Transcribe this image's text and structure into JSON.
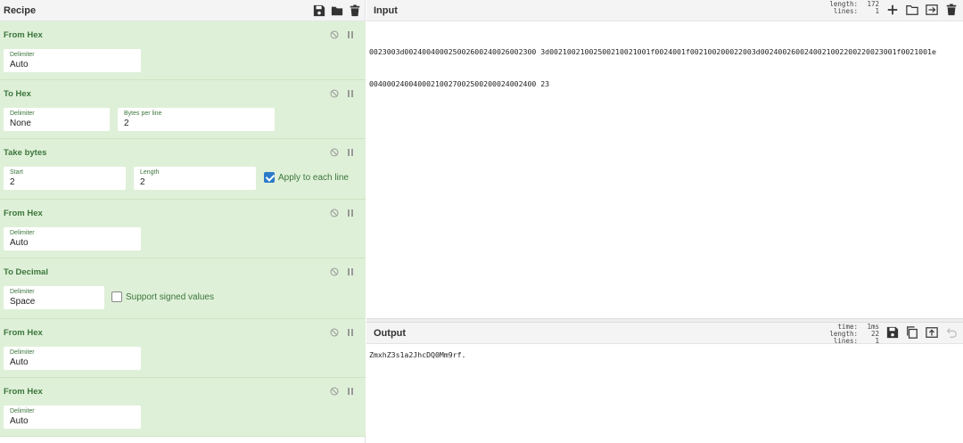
{
  "recipe": {
    "title": "Recipe",
    "icons": [
      "save-icon",
      "folder-icon",
      "trash-icon"
    ],
    "ops": [
      {
        "name": "From Hex",
        "fields": [
          {
            "label": "Delimiter",
            "value": "Auto"
          }
        ]
      },
      {
        "name": "To Hex",
        "fields": [
          {
            "label": "Delimiter",
            "value": "None"
          },
          {
            "label": "Bytes per line",
            "value": "2"
          }
        ]
      },
      {
        "name": "Take bytes",
        "fields": [
          {
            "label": "Start",
            "value": "2"
          },
          {
            "label": "Length",
            "value": "2"
          }
        ],
        "checkbox": {
          "label": "Apply to each line",
          "checked": true
        }
      },
      {
        "name": "From Hex",
        "fields": [
          {
            "label": "Delimiter",
            "value": "Auto"
          }
        ]
      },
      {
        "name": "To Decimal",
        "fields": [
          {
            "label": "Delimiter",
            "value": "Space"
          }
        ],
        "checkbox": {
          "label": "Support signed values",
          "checked": false
        }
      },
      {
        "name": "From Hex",
        "fields": [
          {
            "label": "Delimiter",
            "value": "Auto"
          }
        ]
      },
      {
        "name": "From Hex",
        "fields": [
          {
            "label": "Delimiter",
            "value": "Auto"
          }
        ]
      }
    ]
  },
  "input": {
    "title": "Input",
    "stats": {
      "length_label": "length:",
      "length": "172",
      "lines_label": "lines:",
      "lines": "1"
    },
    "line1": "0023003d002400400025002600240026002300 3d00210021002500210021001f0024001f002100200022003d0024002600240021002200220023001f0021001e",
    "line2": "00400024004000210027002500200024002400 23"
  },
  "output": {
    "title": "Output",
    "stats": {
      "time_label": "time:",
      "time": "1ms",
      "length_label": "length:",
      "length": "22",
      "lines_label": "lines:",
      "lines": "1"
    },
    "text": "ZmxhZ3s1a2JhcDQ0Mm9rf."
  }
}
